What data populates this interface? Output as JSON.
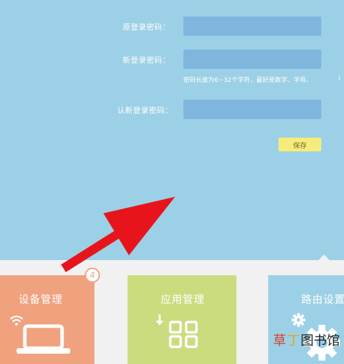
{
  "form": {
    "old_password_label": "原登录密码：",
    "new_password_label": "新登录密码：",
    "hint": "密码长度为6~32个字符，最好是数字、字母、",
    "hint_overflow": "i",
    "confirm_password_label": "认新登录密码：",
    "save_label": "保存"
  },
  "tiles": {
    "devices": {
      "title": "设备管理",
      "badge": "4"
    },
    "apps": {
      "title": "应用管理"
    },
    "router": {
      "title": "路由设置"
    }
  },
  "watermark": {
    "c1": "草",
    "c2": "丁",
    "rest": "图书馆"
  },
  "colors": {
    "background": "#9cd0e6",
    "input": "#7fb6de",
    "save_button": "#f5ec7c",
    "devices_tile": "#f0a27f",
    "apps_tile": "#cbdc7f",
    "router_tile": "#9cd0e6",
    "arrow": "#e8141c"
  }
}
